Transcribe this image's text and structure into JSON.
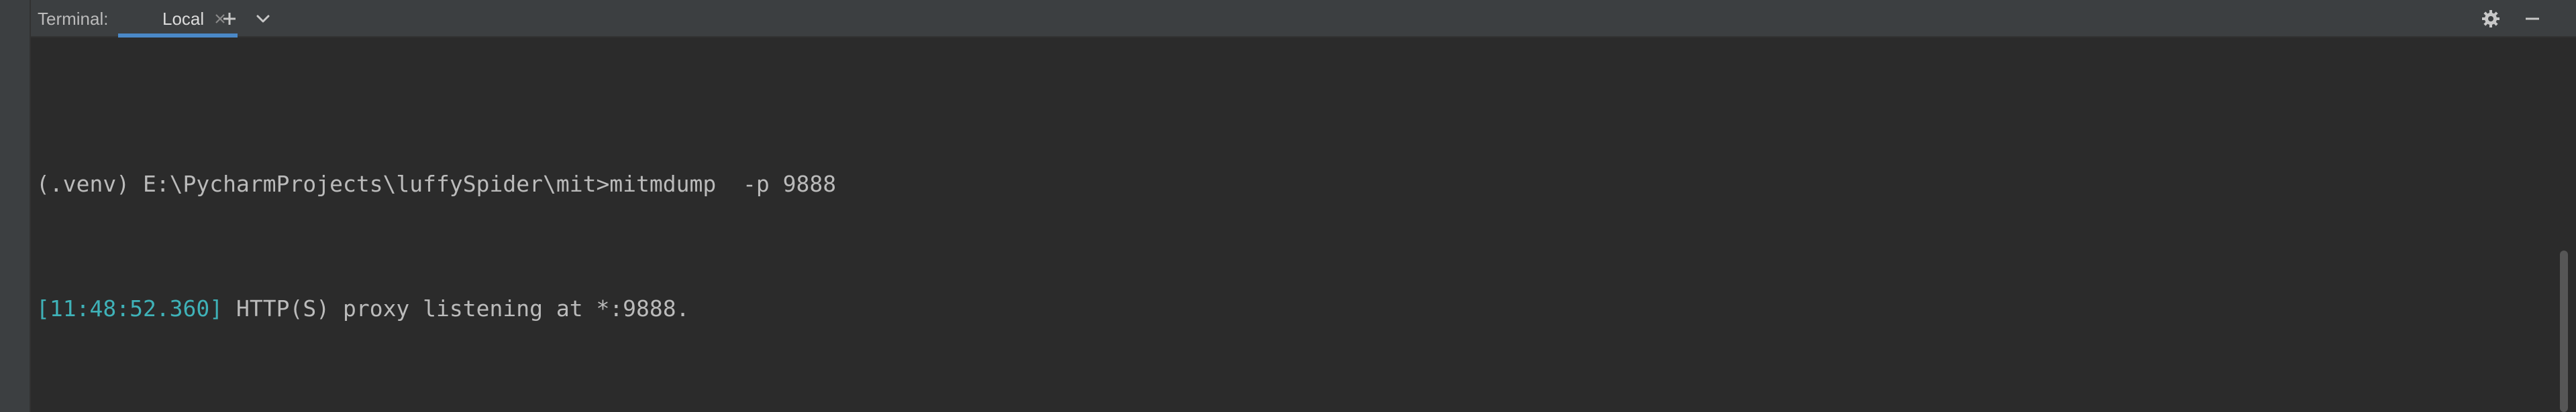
{
  "toolbar": {
    "title": "Terminal:",
    "tab_label": "Local",
    "new_tab_icon": "plus-icon",
    "dropdown_icon": "chevron-down-icon",
    "settings_icon": "gear-icon",
    "hide_icon": "minimize-icon"
  },
  "terminal": {
    "line1": "(.venv) E:\\PycharmProjects\\luffySpider\\mit>mitmdump  -p 9888",
    "line2_timestamp": "[11:48:52.360]",
    "line2_message": " HTTP(S) proxy listening at *:9888."
  },
  "colors": {
    "background": "#2b2b2b",
    "toolbar": "#3c3f41",
    "tab_underline": "#4a88c7",
    "text": "#bbbbbb",
    "timestamp": "#3fb2b8"
  }
}
